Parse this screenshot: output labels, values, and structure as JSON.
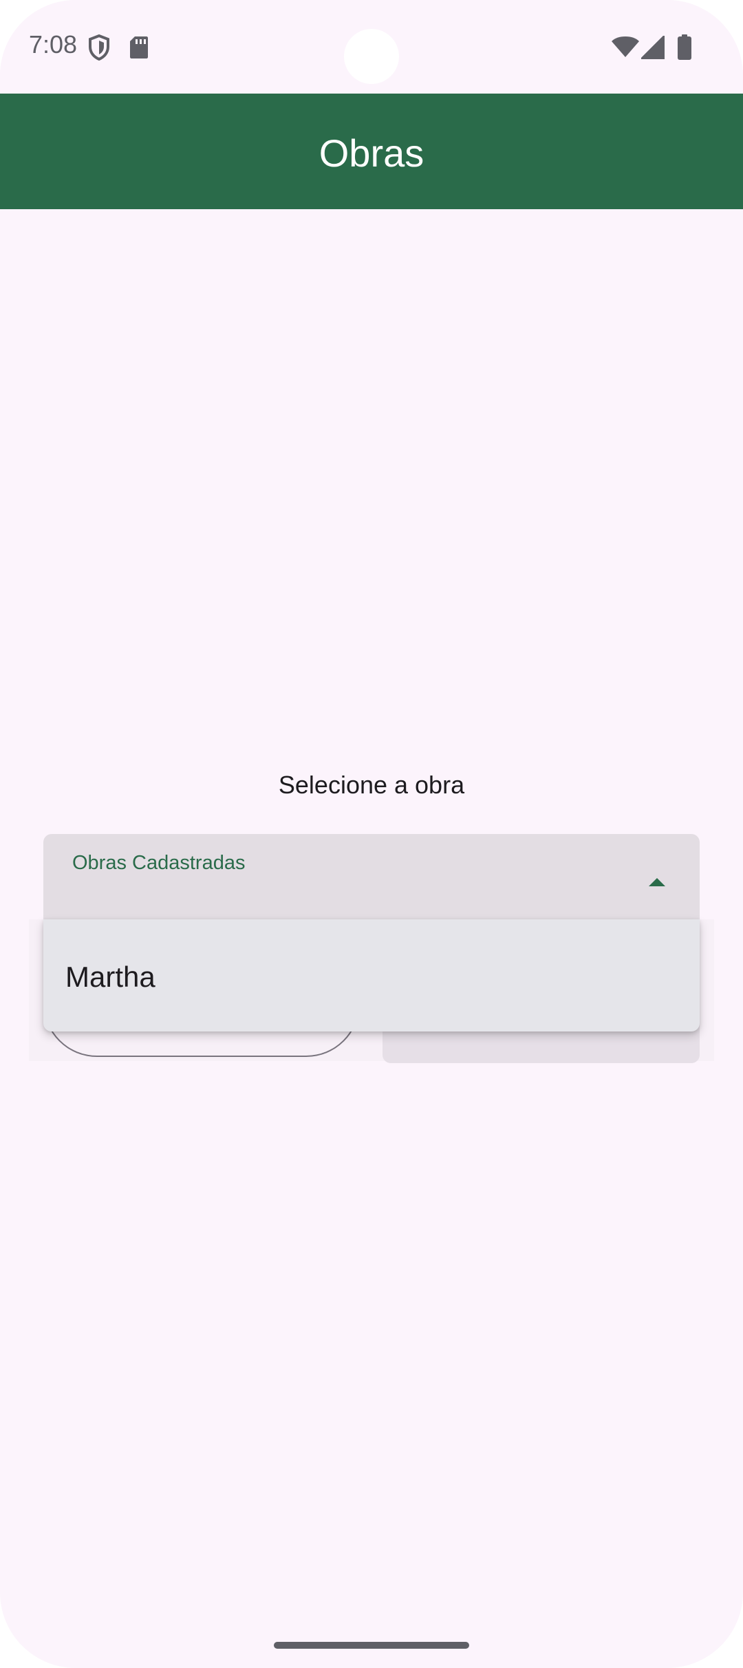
{
  "status_bar": {
    "time": "7:08",
    "left_icons": [
      "shield-icon",
      "sd-card-icon"
    ],
    "right_icons": [
      "wifi-icon",
      "signal-icon",
      "battery-icon"
    ]
  },
  "app_bar": {
    "title": "Obras",
    "background_color": "#2a6b4a"
  },
  "main": {
    "prompt": "Selecione a obra",
    "dropdown": {
      "label": "Obras Cadastradas",
      "value": "",
      "expanded": true,
      "arrow_icon": "arrow-drop-up-icon",
      "options": [
        "Martha"
      ]
    }
  },
  "colors": {
    "accent": "#2a6b4a",
    "background": "#fcf4fc",
    "field": "#e3dde3",
    "menu": "#e5e5ea"
  }
}
